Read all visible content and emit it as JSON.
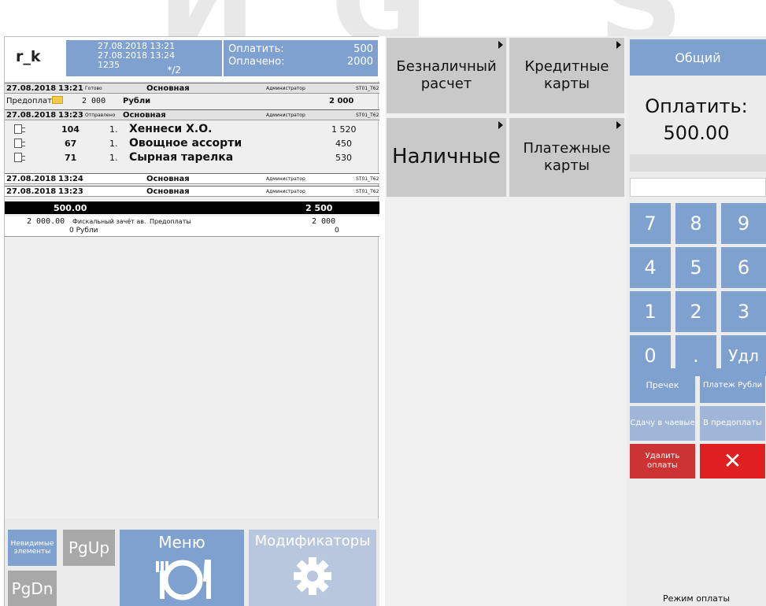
{
  "watermark": {
    "letters": [
      "И",
      "G",
      "S"
    ]
  },
  "header": {
    "user": "r_k",
    "date_open": "27.08.2018 13:21",
    "date_current": "27.08.2018 13:24",
    "order_number": "1235",
    "order_suffix": "*/2",
    "to_pay_label": "Оплатить:",
    "to_pay_value": "500",
    "paid_label": "Оплачено:",
    "paid_value": "2000"
  },
  "order": {
    "rows": [
      {
        "date": "27.08.2018",
        "time": "13:21",
        "status": "Готово",
        "type": "Основная",
        "user": "Администратор",
        "station": "ST01_T62"
      },
      {
        "date": "27.08.2018",
        "time": "13:23",
        "status": "Отправлено",
        "type": "Основная",
        "user": "Администратор",
        "station": "ST01_T62"
      },
      {
        "date": "27.08.2018",
        "time": "13:24",
        "status": "",
        "type": "Основная",
        "user": "Администратор",
        "station": "ST01_T62"
      },
      {
        "date": "27.08.2018",
        "time": "13:23",
        "status": "",
        "type": "Основная",
        "user": "Администратор",
        "station": "ST01_T62"
      }
    ],
    "prepay": {
      "label": "Предоплата",
      "amount": "2 000",
      "currency": "Рубли",
      "total": "2 000"
    },
    "items": [
      {
        "code": "104",
        "qty": "1.",
        "name": "Хеннеси Х.О.",
        "price": "1 520"
      },
      {
        "code": "67",
        "qty": "1.",
        "name": "Овощное ассорти",
        "price": "450"
      },
      {
        "code": "71",
        "qty": "1.",
        "name": "Сырная тарелка",
        "price": "530"
      }
    ],
    "total_left": "500.00",
    "total_right": "2 500",
    "footer_line1_left": "2 000.00",
    "footer_line1_text": "Фискальный зачёт ав.",
    "footer_line1_mid": "Предоплаты",
    "footer_line1_right": "2 000",
    "footer_line2_left": "0 Рубли",
    "footer_line2_right": "0"
  },
  "left_buttons": {
    "invisible": "Невидимые элементы",
    "pgup": "PgUp",
    "pgdn": "PgDn",
    "menu": "Меню",
    "modifiers": "Модификаторы"
  },
  "payment_methods": [
    {
      "label": "Безналичный расчет"
    },
    {
      "label": "Кредитные карты"
    },
    {
      "label": "Наличные"
    },
    {
      "label": "Платежные карты"
    }
  ],
  "right": {
    "tab_general": "Общий",
    "pay_label": "Оплатить:",
    "pay_value": "500.00",
    "keys": [
      "7",
      "8",
      "9",
      "4",
      "5",
      "6",
      "1",
      "2",
      "3",
      "0",
      ".",
      "Удл"
    ],
    "precheck": "Пречек",
    "pay_rub": "Платеж Рубли",
    "tip_change": "Сдачу в чаевые",
    "to_prepay": "В предоплаты",
    "delete_payments": "Удалить оплаты",
    "cancel_symbol": "✕",
    "mode_label": "Режим оплаты"
  },
  "colors": {
    "accent": "#7fa1cf",
    "danger": "#cc3333",
    "button_grey": "#c9c9c9"
  }
}
